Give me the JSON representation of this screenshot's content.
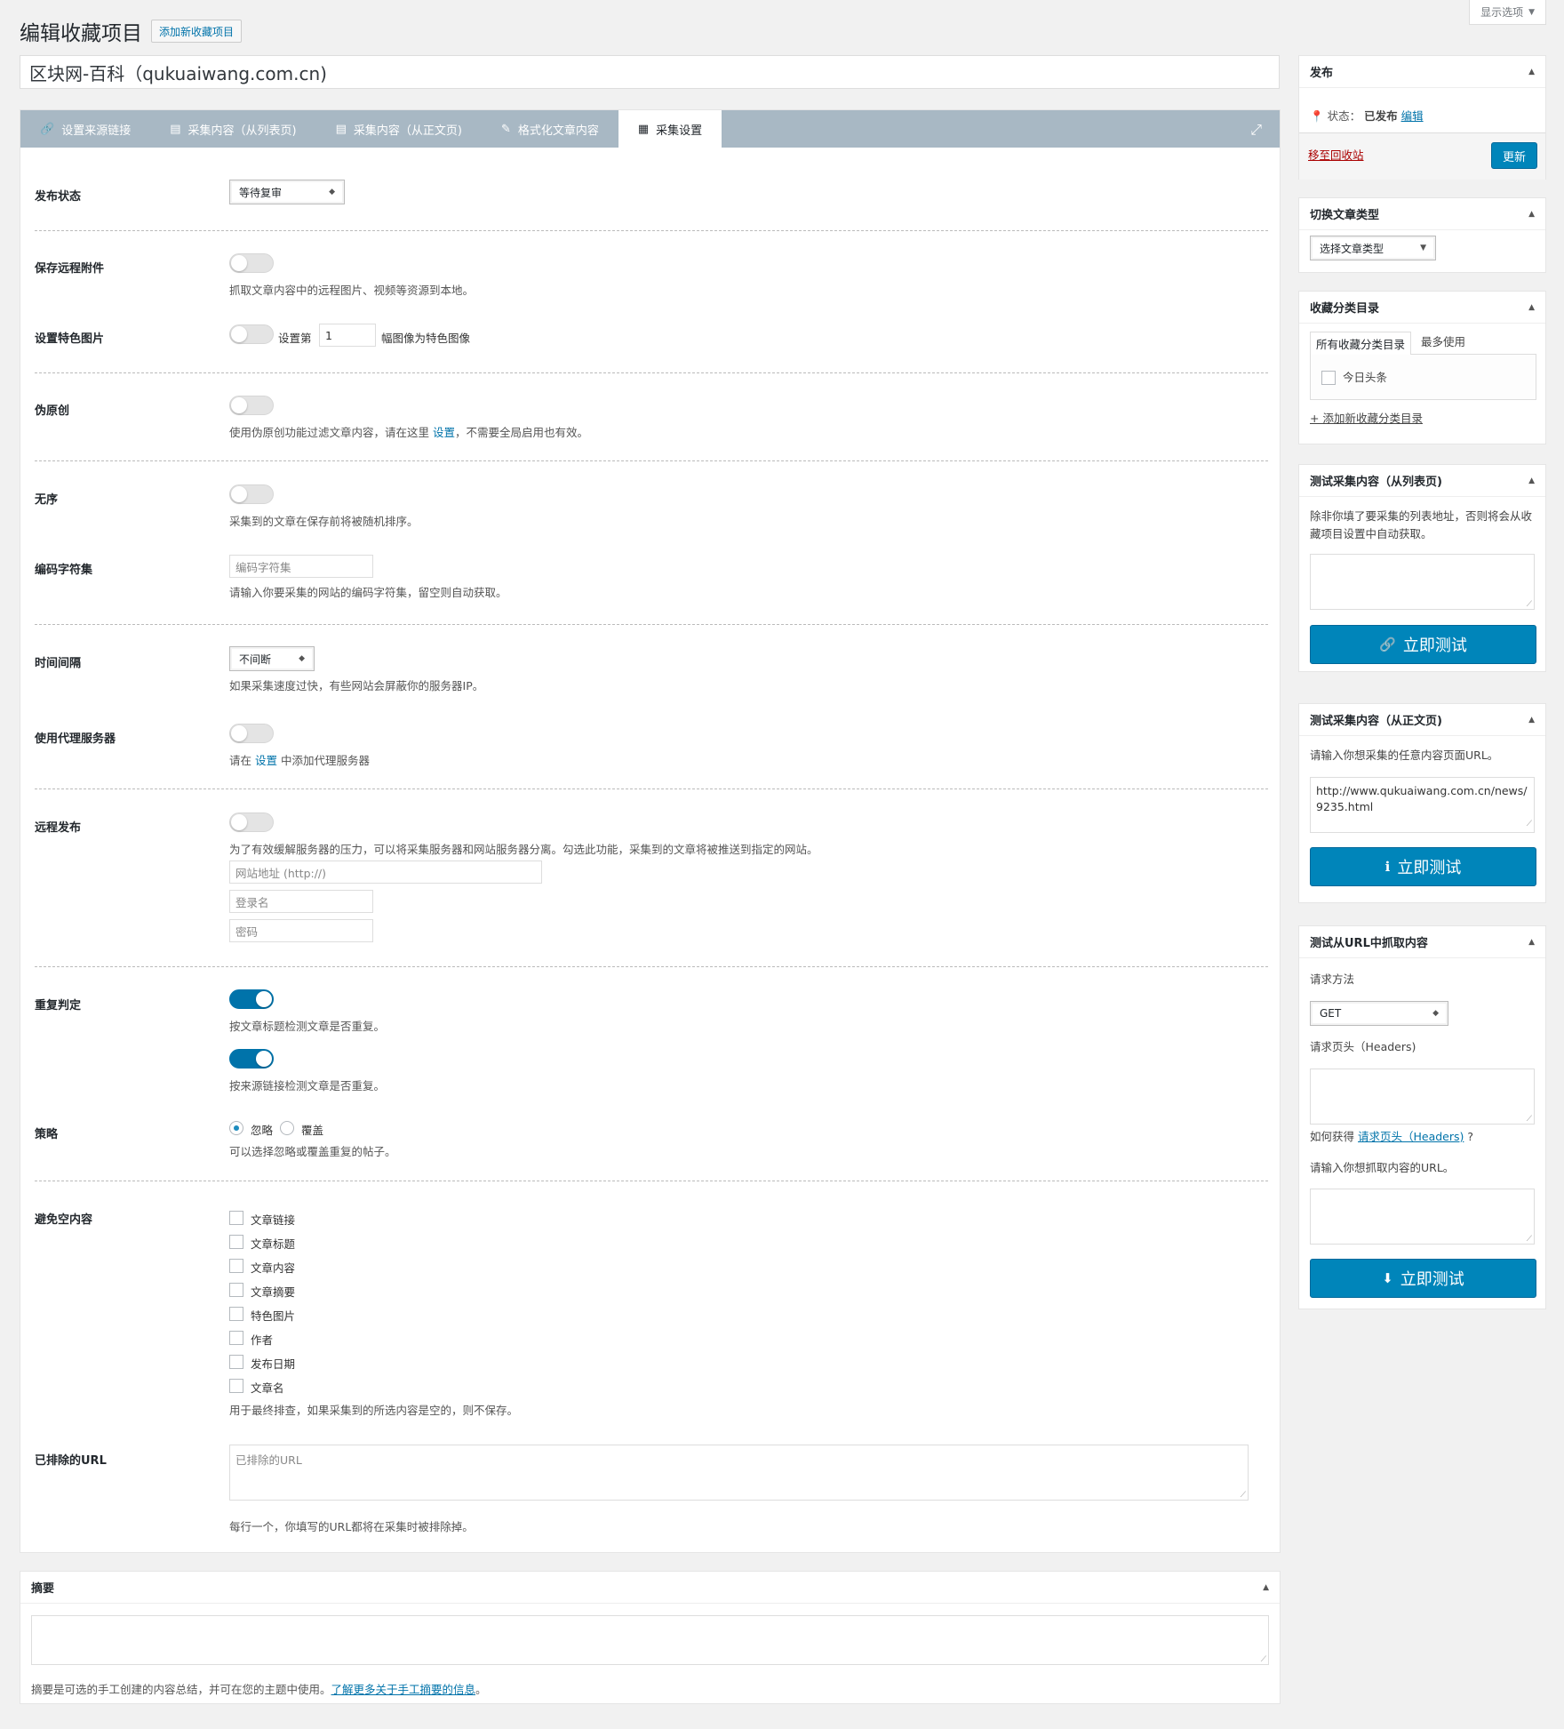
{
  "header": {
    "screen_options": "显示选项",
    "page_title": "编辑收藏项目",
    "add_new": "添加新收藏项目",
    "post_title": "区块网-百科（qukuaiwang.com.cn)"
  },
  "tabs": [
    {
      "label": "设置来源链接",
      "icon": "link-icon"
    },
    {
      "label": "采集内容（从列表页)",
      "icon": "list-icon"
    },
    {
      "label": "采集内容（从正文页)",
      "icon": "list-icon"
    },
    {
      "label": "格式化文章内容",
      "icon": "pencil-icon"
    },
    {
      "label": "采集设置",
      "icon": "grid-icon"
    }
  ],
  "settings": {
    "publish_status": {
      "label": "发布状态",
      "value": "等待复审"
    },
    "save_remote": {
      "label": "保存远程附件",
      "desc": "抓取文章内容中的远程图片、视频等资源到本地。"
    },
    "featured_image": {
      "label": "设置特色图片",
      "pre": "设置第",
      "value": "1",
      "post": "幅图像为特色图像"
    },
    "pseudo_original": {
      "label": "伪原创",
      "desc_pre": "使用伪原创功能过滤文章内容，请在这里",
      "link": "设置",
      "desc_post": "，不需要全局启用也有效。"
    },
    "random_order": {
      "label": "无序",
      "desc": "采集到的文章在保存前将被随机排序。"
    },
    "charset": {
      "label": "编码字符集",
      "placeholder": "编码字符集",
      "desc": "请输入你要采集的网站的编码字符集，留空则自动获取。"
    },
    "interval": {
      "label": "时间间隔",
      "value": "不间断",
      "desc": "如果采集速度过快，有些网站会屏蔽你的服务器IP。"
    },
    "proxy": {
      "label": "使用代理服务器",
      "desc_pre": "请在",
      "link": "设置",
      "desc_post": "中添加代理服务器"
    },
    "remote_publish": {
      "label": "远程发布",
      "desc": "为了有效缓解服务器的压力，可以将采集服务器和网站服务器分离。勾选此功能，采集到的文章将被推送到指定的网站。",
      "site_placeholder": "网站地址 (http://)",
      "user_placeholder": "登录名",
      "pass_placeholder": "密码"
    },
    "duplicate": {
      "label": "重复判定",
      "desc1": "按文章标题检测文章是否重复。",
      "desc2": "按来源链接检测文章是否重复。"
    },
    "strategy": {
      "label": "策略",
      "opt1": "忽略",
      "opt2": "覆盖",
      "desc": "可以选择忽略或覆盖重复的帖子。"
    },
    "avoid_empty": {
      "label": "避免空内容",
      "items": [
        "文章链接",
        "文章标题",
        "文章内容",
        "文章摘要",
        "特色图片",
        "作者",
        "发布日期",
        "文章名"
      ],
      "desc": "用于最终排查，如果采集到的所选内容是空的，则不保存。"
    },
    "excluded_urls": {
      "label": "已排除的URL",
      "placeholder": "已排除的URL",
      "desc": "每行一个，你填写的URL都将在采集时被排除掉。"
    }
  },
  "excerpt": {
    "title": "摘要",
    "desc_pre": "摘要是可选的手工创建的内容总结，并可在您的主题中使用。",
    "link": "了解更多关于手工摘要的信息",
    "desc_post": "。"
  },
  "sidebar": {
    "publish": {
      "title": "发布",
      "status_label": "状态：",
      "status_value": "已发布",
      "edit": "编辑",
      "trash": "移至回收站",
      "update": "更新"
    },
    "post_type": {
      "title": "切换文章类型",
      "value": "选择文章类型"
    },
    "category": {
      "title": "收藏分类目录",
      "tab_all": "所有收藏分类目录",
      "tab_most": "最多使用",
      "item": "今日头条",
      "add": "+ 添加新收藏分类目录"
    },
    "test_list": {
      "title": "测试采集内容（从列表页)",
      "desc": "除非你填了要采集的列表地址，否则将会从收藏项目设置中自动获取。",
      "button": "立即测试"
    },
    "test_article": {
      "title": "测试采集内容（从正文页)",
      "desc": "请输入你想采集的任意内容页面URL。",
      "url": "http://www.qukuaiwang.com.cn/news/9235.html",
      "button": "立即测试"
    },
    "test_fetch": {
      "title": "测试从URL中抓取内容",
      "method_label": "请求方法",
      "method": "GET",
      "headers_label": "请求页头（Headers)",
      "how_pre": "如何获得",
      "how_link": "请求页头（Headers)",
      "how_post": "?",
      "url_label": "请输入你想抓取内容的URL。",
      "button": "立即测试"
    }
  }
}
